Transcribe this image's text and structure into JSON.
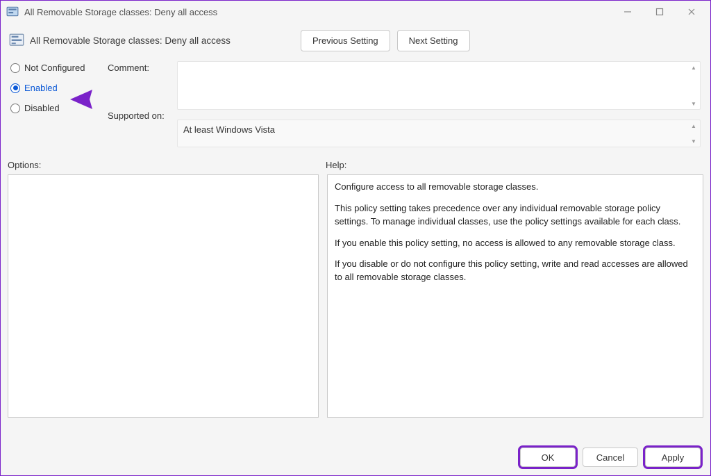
{
  "window": {
    "title": "All Removable Storage classes: Deny all access"
  },
  "header": {
    "policy_name": "All Removable Storage classes: Deny all access",
    "prev_btn": "Previous Setting",
    "next_btn": "Next Setting"
  },
  "state": {
    "options": [
      {
        "value": "not_configured",
        "label": "Not Configured",
        "selected": false
      },
      {
        "value": "enabled",
        "label": "Enabled",
        "selected": true
      },
      {
        "value": "disabled",
        "label": "Disabled",
        "selected": false
      }
    ],
    "comment_label": "Comment:",
    "comment_value": "",
    "supported_label": "Supported on:",
    "supported_value": "At least Windows Vista"
  },
  "panes": {
    "options_label": "Options:",
    "help_label": "Help:",
    "help_paragraphs": [
      "Configure access to all removable storage classes.",
      "This policy setting takes precedence over any individual removable storage policy settings. To manage individual classes, use the policy settings available for each class.",
      "If you enable this policy setting, no access is allowed to any removable storage class.",
      "If you disable or do not configure this policy setting, write and read accesses are allowed to all removable storage classes."
    ]
  },
  "footer": {
    "ok": "OK",
    "cancel": "Cancel",
    "apply": "Apply"
  },
  "colors": {
    "accent_annotation": "#7a22c9",
    "radio_selected": "#0a58d6"
  }
}
